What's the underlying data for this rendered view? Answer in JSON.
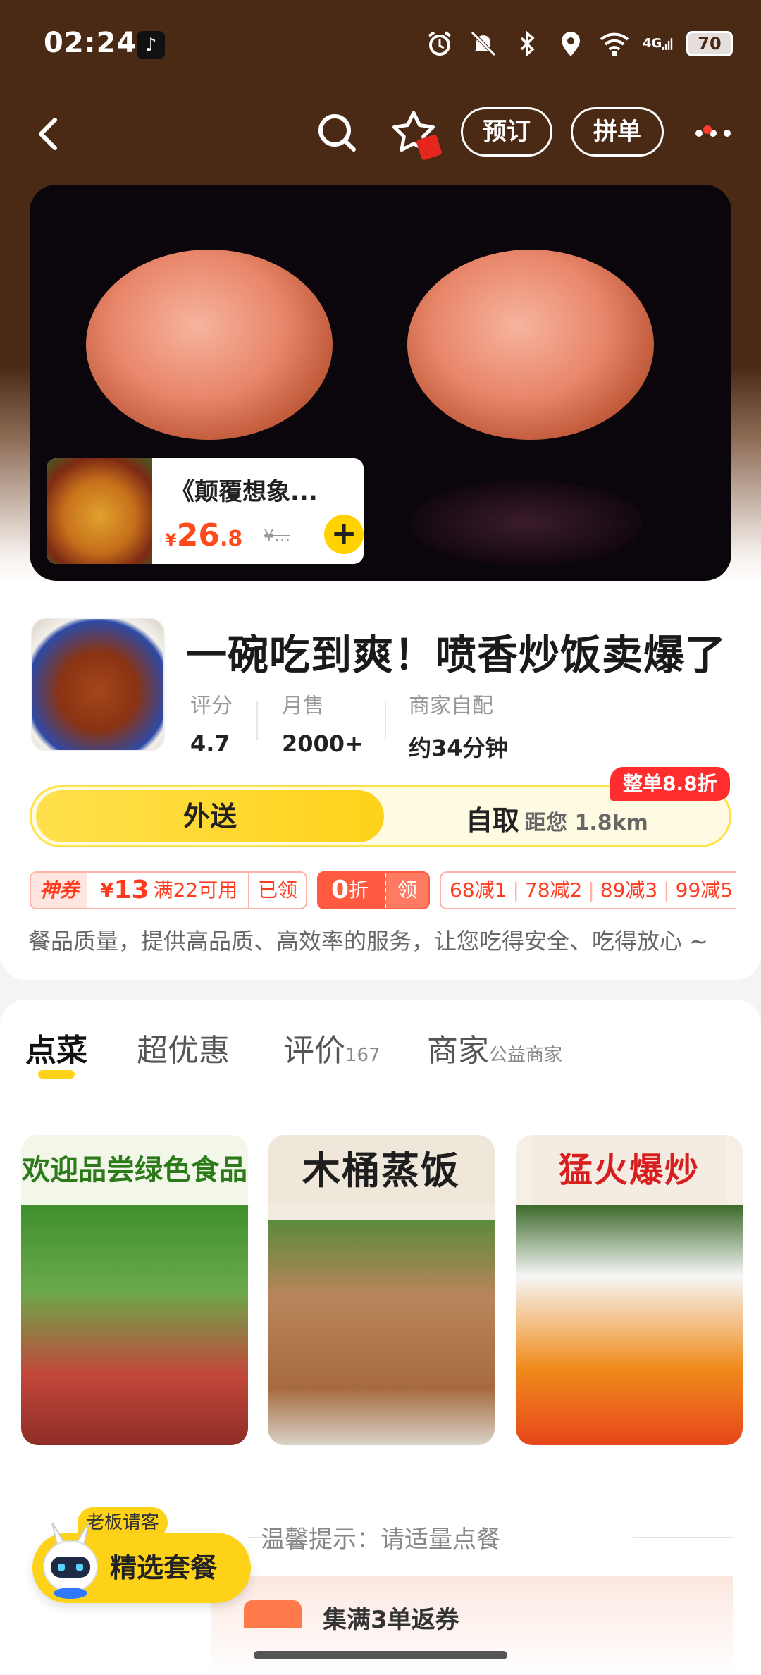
{
  "status_bar": {
    "time": "02:24",
    "network": "4G",
    "battery": "70"
  },
  "nav": {
    "book_label": "预订",
    "group_label": "拼单"
  },
  "video": {
    "promo": {
      "title": "《颠覆想象...",
      "currency": "¥",
      "price_int": "26",
      "price_dec": ".8",
      "original": "¥..."
    }
  },
  "shop": {
    "name": "一碗吃到爽！喷香炒饭卖爆了",
    "stats": [
      {
        "label": "评分",
        "value": "4.7"
      },
      {
        "label": "月售",
        "value": "2000+"
      },
      {
        "label": "商家自配",
        "value": "约34分钟"
      }
    ],
    "modes": {
      "delivery": "外送",
      "pickup": "自取",
      "distance": "距您 1.8km"
    },
    "discount_badge": "整单8.8折",
    "coupons": {
      "god_tag": "神券",
      "god_currency": "¥",
      "god_amount": "13",
      "god_rule": "满22可用",
      "god_status": "已领",
      "zero_value": "0",
      "zero_unit": "折",
      "zero_action": "领",
      "reductions": [
        "68减1",
        "78减2",
        "89减3",
        "99减5"
      ]
    },
    "slogan": "餐品质量，提供高品质、高效率的服务，让您吃得安全、吃得放心 ~"
  },
  "tabs": [
    {
      "label": "点菜",
      "sub": ""
    },
    {
      "label": "超优惠",
      "sub": ""
    },
    {
      "label": "评价",
      "sub": "167"
    },
    {
      "label": "商家",
      "sub": "公益商家"
    }
  ],
  "banners": [
    {
      "title": "欢迎品尝绿色食品"
    },
    {
      "title": "木桶蒸饭"
    },
    {
      "title": "猛火爆炒"
    }
  ],
  "tip": "温馨提示：请适量点餐",
  "peach_text": "集满3单返券",
  "float": {
    "bubble": "老板请客",
    "label": "精选套餐"
  },
  "colors": {
    "brand_yellow": "#ffd21a",
    "accent_red": "#ff3b1f",
    "header_brown": "#4b2a15"
  }
}
